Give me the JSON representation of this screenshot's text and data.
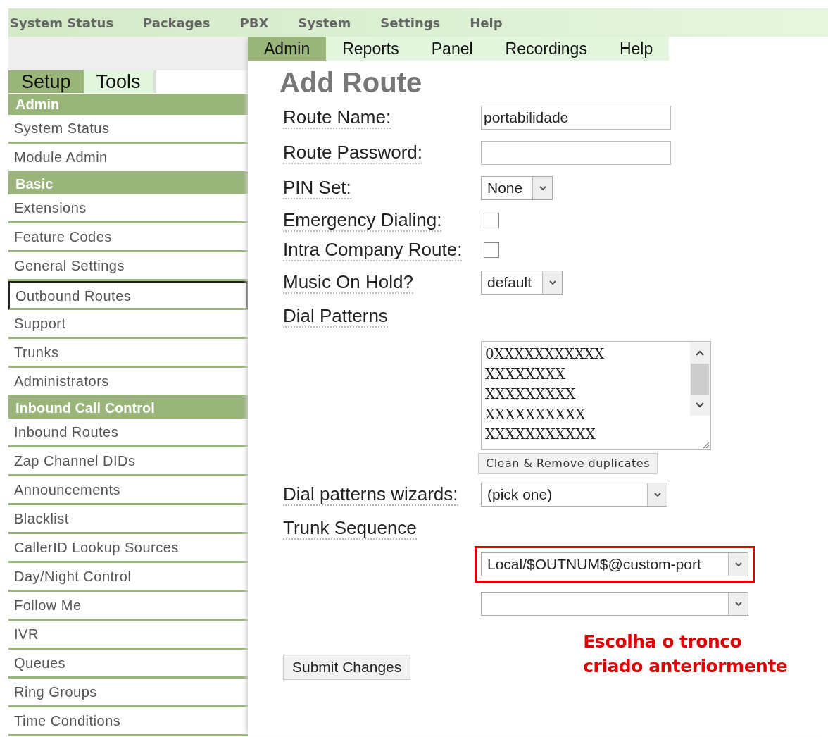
{
  "top_menu": [
    "System Status",
    "Packages",
    "PBX",
    "System",
    "Settings",
    "Help"
  ],
  "sub_tabs": [
    {
      "label": "Admin",
      "selected": true
    },
    {
      "label": "Reports",
      "selected": false
    },
    {
      "label": "Panel",
      "selected": false
    },
    {
      "label": "Recordings",
      "selected": false
    },
    {
      "label": "Help",
      "selected": false
    }
  ],
  "sidebar": {
    "tabs": [
      {
        "label": "Setup",
        "selected": true
      },
      {
        "label": "Tools",
        "selected": false
      }
    ],
    "sections": [
      {
        "title": "Admin",
        "items": [
          {
            "label": "System Status",
            "selected": false
          },
          {
            "label": "Module Admin",
            "selected": false
          }
        ]
      },
      {
        "title": "Basic",
        "items": [
          {
            "label": "Extensions",
            "selected": false
          },
          {
            "label": "Feature Codes",
            "selected": false
          },
          {
            "label": "General Settings",
            "selected": false
          },
          {
            "label": "Outbound Routes",
            "selected": true
          },
          {
            "label": "Support",
            "selected": false
          },
          {
            "label": "Trunks",
            "selected": false
          },
          {
            "label": "Administrators",
            "selected": false
          }
        ]
      },
      {
        "title": "Inbound Call Control",
        "items": [
          {
            "label": "Inbound Routes",
            "selected": false
          },
          {
            "label": "Zap Channel DIDs",
            "selected": false
          },
          {
            "label": "Announcements",
            "selected": false
          },
          {
            "label": "Blacklist",
            "selected": false
          },
          {
            "label": "CallerID Lookup Sources",
            "selected": false
          },
          {
            "label": "Day/Night Control",
            "selected": false
          },
          {
            "label": "Follow Me",
            "selected": false
          },
          {
            "label": "IVR",
            "selected": false
          },
          {
            "label": "Queues",
            "selected": false
          },
          {
            "label": "Ring Groups",
            "selected": false
          },
          {
            "label": "Time Conditions",
            "selected": false
          }
        ]
      }
    ]
  },
  "form": {
    "title": "Add Route",
    "fields": [
      {
        "kind": "text",
        "label": "Route Name:",
        "value": "portabilidade"
      },
      {
        "kind": "text",
        "label": "Route Password:"
      },
      {
        "kind": "select",
        "label": "PIN Set:",
        "value": "None"
      },
      {
        "kind": "checkbox",
        "label": "Emergency Dialing:",
        "checked": false
      },
      {
        "kind": "checkbox",
        "label": "Intra Company Route:",
        "checked": false
      },
      {
        "kind": "select",
        "label": "Music On Hold?",
        "value": "default"
      }
    ],
    "dial_patterns": {
      "label": "Dial Patterns",
      "lines": [
        "0XXXXXXXXXXX",
        "XXXXXXXX",
        "XXXXXXXXX",
        "XXXXXXXXXX",
        "XXXXXXXXXXX"
      ],
      "button": "Clean & Remove duplicates"
    },
    "wizard": {
      "label": "Dial patterns wizards:",
      "value": "(pick one)"
    },
    "trunk_sequence": {
      "label": "Trunk Sequence",
      "trunks": [
        {
          "value": "Local/$OUTNUM$@custom-port",
          "highlighted": true
        },
        {
          "highlighted": false
        }
      ]
    },
    "submit": "Submit Changes"
  },
  "note": "Escolha o tronco criado anteriormente"
}
